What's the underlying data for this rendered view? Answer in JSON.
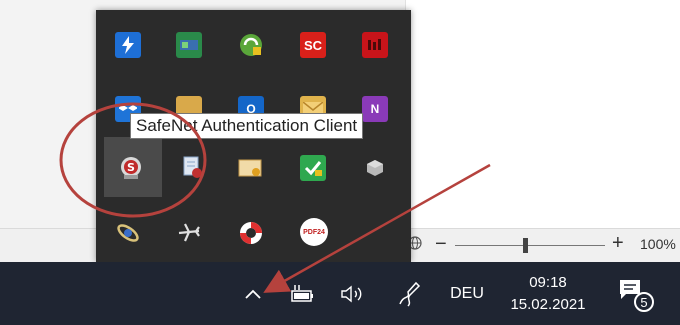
{
  "tooltip": {
    "text": "SafeNet Authentication Client"
  },
  "taskbar": {
    "language": "DEU",
    "time": "09:18",
    "date": "15.02.2021",
    "notification_count": "5"
  },
  "status_bar": {
    "zoom_minus": "−",
    "zoom_plus": "+",
    "zoom_level": "100%",
    "zoom_fraction": 0.47
  },
  "tray_icons": [
    {
      "name": "thunderbolt-icon",
      "color": "#1e6fd6"
    },
    {
      "name": "network-drive-icon",
      "color": "#2a8a4a"
    },
    {
      "name": "sync-green-icon",
      "color": "#5aa63a"
    },
    {
      "name": "sc-red-icon",
      "color": "#d9201a",
      "label": "SC"
    },
    {
      "name": "red-app-icon",
      "color": "#c8141a"
    },
    {
      "name": "dropbox-icon",
      "color": "#1f74d8"
    },
    {
      "name": "mail-folder-icon",
      "color": "#d9a94a"
    },
    {
      "name": "outlook-icon",
      "color": "#1466c8"
    },
    {
      "name": "envelope-icon",
      "color": "#e0b34c"
    },
    {
      "name": "onenote-icon",
      "color": "#8a3ab8"
    },
    {
      "name": "safenet-icon",
      "color": "#c02a2a"
    },
    {
      "name": "document-gear-icon",
      "color": "#8aa6c8"
    },
    {
      "name": "certificate-mail-icon",
      "color": "#d6b06a"
    },
    {
      "name": "shield-check-icon",
      "color": "#2fa84f"
    },
    {
      "name": "cube-icon",
      "color": "#b9b9b9"
    },
    {
      "name": "satellite-icon",
      "color": "#d9c27a"
    },
    {
      "name": "airplane-icon",
      "color": "#d0d0d0"
    },
    {
      "name": "lifebuoy-icon",
      "color": "#e03030"
    },
    {
      "name": "pdf24-icon",
      "color": "#d8d8d8",
      "label": "PDF24"
    }
  ],
  "colors": {
    "taskbar_bg": "#1f2532",
    "flyout_bg": "#2b2b2b",
    "annotation_red": "#b5423d"
  }
}
